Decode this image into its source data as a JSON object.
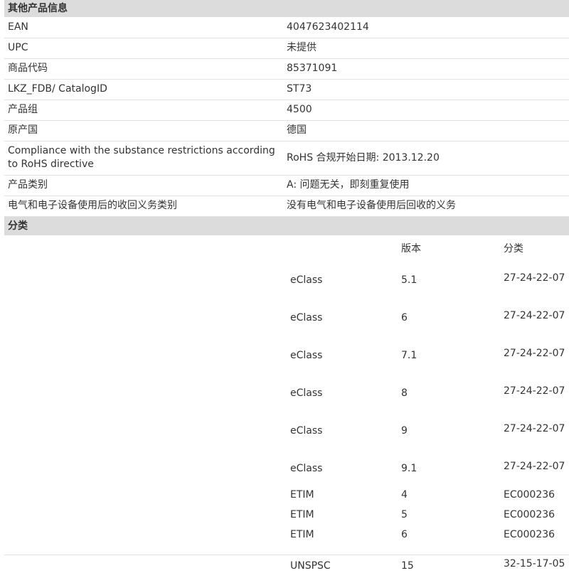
{
  "other_info": {
    "header": "其他产品信息",
    "rows": [
      {
        "label": "EAN",
        "value": "4047623402114"
      },
      {
        "label": "UPC",
        "value": "未提供"
      },
      {
        "label": "商品代码",
        "value": "85371091"
      },
      {
        "label": "LKZ_FDB/ CatalogID",
        "value": "ST73"
      },
      {
        "label": "产品组",
        "value": "4500"
      },
      {
        "label": "原产国",
        "value": "德国"
      },
      {
        "label": "Compliance with the substance restrictions according to RoHS directive",
        "value": "RoHS 合规开始日期: 2013.12.20"
      },
      {
        "label": "产品类别",
        "value": "A: 问题无关，即刻重复使用"
      },
      {
        "label": "电气和电子设备使用后的收回义务类别",
        "value": "没有电气和电子设备使用后回收的义务"
      }
    ]
  },
  "classification": {
    "header": "分类",
    "col_version": "版本",
    "col_class": "分类",
    "rows": [
      {
        "system": "eClass",
        "version": "5.1",
        "code": "27-24-22-07"
      },
      {
        "system": "eClass",
        "version": "6",
        "code": "27-24-22-07"
      },
      {
        "system": "eClass",
        "version": "7.1",
        "code": "27-24-22-07"
      },
      {
        "system": "eClass",
        "version": "8",
        "code": "27-24-22-07"
      },
      {
        "system": "eClass",
        "version": "9",
        "code": "27-24-22-07"
      },
      {
        "system": "eClass",
        "version": "9.1",
        "code": "27-24-22-07"
      },
      {
        "system": "ETIM",
        "version": "4",
        "code": "EC000236"
      },
      {
        "system": "ETIM",
        "version": "5",
        "code": "EC000236"
      },
      {
        "system": "ETIM",
        "version": "6",
        "code": "EC000236"
      },
      {
        "system": "UNSPSC",
        "version": "15",
        "code": "32-15-17-05"
      }
    ]
  }
}
